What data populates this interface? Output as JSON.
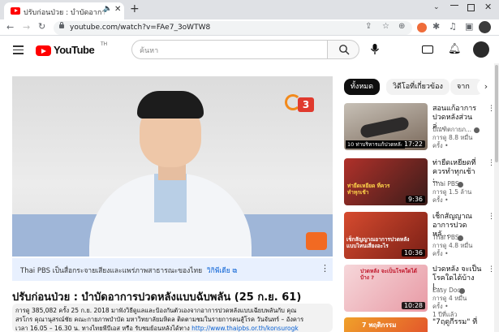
{
  "browser": {
    "tab_title": "ปรับก่อนป่วย : บำบัดอาการปวดห",
    "new_tab": "+",
    "url": "youtube.com/watch?v=FAe7_3oWTW8"
  },
  "header": {
    "logo_text": "YouTube",
    "logo_region": "TH",
    "search_placeholder": "ค้นหา"
  },
  "player": {
    "channel_logo_text": "3"
  },
  "info_panel": {
    "text": "Thai PBS เป็นสื่อกระจายเสียงและแพร่ภาพสาธารณะของไทย",
    "link": "วิกิพีเดีย"
  },
  "video": {
    "title": "ปรับก่อนป่วย : บำบัดอาการปวดหลังแบบฉับพลัน (25 ก.ย. 61)",
    "meta": "การดู 385,082 ครั้ง  25 ก.ย. 2018  มาฟังวิธีดูแลและป้องกันตัวเองจากอาการปวดหลังแบบเฉียบพลันกับ คุณ",
    "desc_line2": "สรโกร คุณานุสรณ์ชัย คณะกายภาพบำบัด มหาวิทยาลัยมหิดล ติดตามชมในรายการคนสู้โรค วันจันทร์ – อังคาร",
    "desc_line3": "เวลา 16.05 – 16.30 น. ทางไทยพีบีเอส หรือ รับชมย้อนหลังได้ทาง",
    "desc_link": "http://www.thaipbs.or.th/konsurogk"
  },
  "chips": [
    "ทั้งหมด",
    "วิดีโอที่เกี่ยวข้อง",
    "จาก"
  ],
  "recommendations": [
    {
      "title_line1": "สอนแก้อาการ",
      "title_line2": "ปวดหลังส่วนล่...",
      "channel": "บัณฑิตกายภ...",
      "views": "การดู 8.8 หมื่น",
      "views2": "ครั้ง •",
      "duration": "17:22",
      "thumb_caption": "10 ท่าบริหารแก้ปวดหลัง"
    },
    {
      "title_line1": "ท่ายืดเหยียดที่",
      "title_line2": "ควรทำทุกเช้า :...",
      "channel": "Thai PBS",
      "views": "การดู 1.5 ล้าน",
      "views2": "ครั้ง •",
      "duration": "9:36",
      "thumb_caption": "ท่ายืดเหยียด ที่ควรทำทุกเช้า"
    },
    {
      "title_line1": "เช็กสัญญาณ",
      "title_line2": "อาการปวดหลั...",
      "channel": "Thai PBS",
      "views": "การดู 4.8 หมื่น",
      "views2": "ครั้ง •",
      "duration": "10:36",
      "thumb_caption": "เช็กสัญญาณอาการปวดหลัง แบบไหนเสี่ยงอะไร"
    },
    {
      "title_line1": "ปวดหลัง จะเป็น",
      "title_line2": "โรคใดได้บ้าง |...",
      "channel": "Easy Doc",
      "views": "การดู 4 หมื่น",
      "views2": "ครั้ง •",
      "views3": "1 ปีที่แล้ว",
      "duration": "10:28",
      "thumb_caption": "ปวดหลัง จะเป็นโรคใดได้บ้าง ?"
    },
    {
      "title_line1": "\"7ฤดูกีรรม\" ที่",
      "title_line2": "",
      "channel": "",
      "views": "",
      "views2": "",
      "duration": "",
      "thumb_caption": "7 พฤติกรรม"
    }
  ],
  "colors": {
    "yt_red": "#ff0000",
    "chip_active_bg": "#0f0f0f",
    "chip_bg": "#f2f2f2",
    "info_bg": "#e8f0fe"
  }
}
